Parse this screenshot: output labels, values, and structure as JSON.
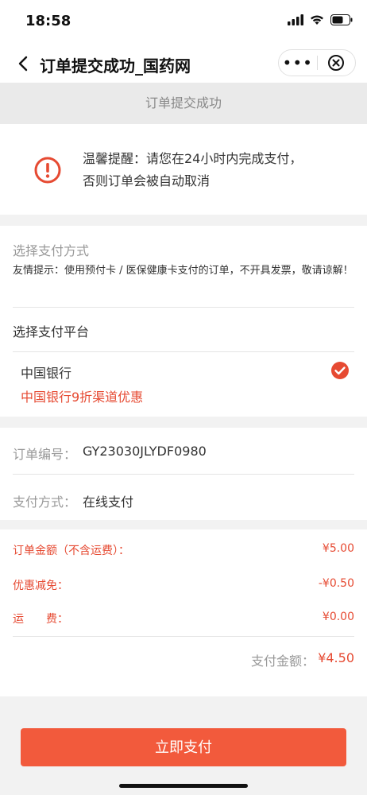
{
  "status_bar": {
    "time": "18:58"
  },
  "nav": {
    "title": "订单提交成功_国药网",
    "more": "•••"
  },
  "page_header": "订单提交成功",
  "notice": {
    "line1": "温馨提醒：请您在24小时内完成支付，",
    "line2": "否则订单会被自动取消"
  },
  "payment": {
    "title": "选择支付方式",
    "tip": "友情提示：使用预付卡 / 医保健康卡支付的订单，不开具发票，敬请谅解！",
    "platform_title": "选择支付平台",
    "bank_name": "中国银行",
    "bank_promo": "中国银行9折渠道优惠"
  },
  "order": {
    "number_label": "订单编号：",
    "number_value": "GY23030JLYDF0980",
    "method_label": "支付方式：",
    "method_value": "在线支付"
  },
  "amounts": {
    "order_amount_label": "订单金额（不含运费）：",
    "order_amount_value": "¥5.00",
    "discount_label": "优惠减免：",
    "discount_value": "-¥0.50",
    "shipping_label": "运　　费：",
    "shipping_value": "¥0.00",
    "total_label": "支付金额：",
    "total_value": "¥4.50"
  },
  "button": {
    "pay_label": "立即支付"
  },
  "colors": {
    "accent": "#e64a32",
    "button": "#f25a3c"
  }
}
